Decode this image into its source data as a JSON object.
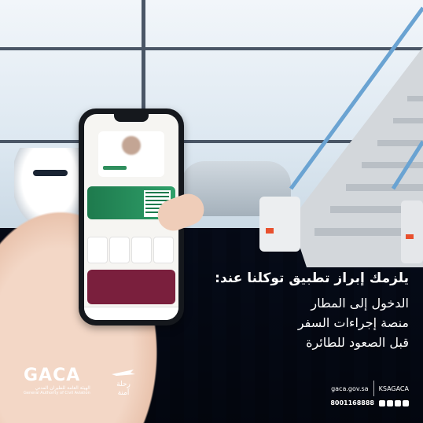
{
  "headline": {
    "title": "يلزمك إبراز تطبيق توكلنا عند:",
    "lines": [
      "الدخول إلى المطار",
      "منصة إجراءات السفر",
      "قبل الصعود للطائرة"
    ]
  },
  "brand": {
    "logo_text": "GACA",
    "arabic_name": "الهيئة العامة للطيران المدني",
    "english_name": "General Authority of Civil Aviation",
    "badge_text": "رحلة آمنة"
  },
  "footer": {
    "handle": "KSAGACA",
    "website": "gaca.gov.sa",
    "phone": "8001168888",
    "social_icons": [
      "twitter-icon",
      "instagram-icon",
      "facebook-icon",
      "youtube-icon"
    ]
  },
  "colors": {
    "app_green": "#2f8e5d",
    "banner_maroon": "#7a1f3d",
    "floor_navy": "#1f2d44"
  }
}
